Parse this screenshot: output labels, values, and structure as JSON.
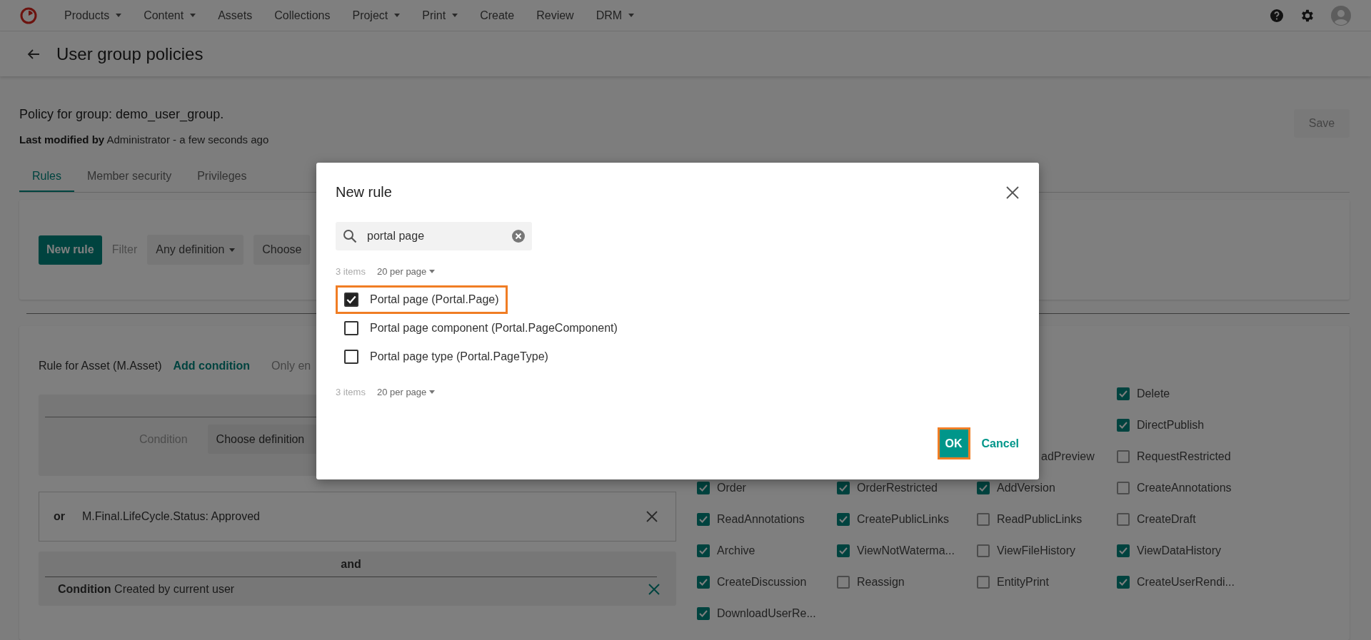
{
  "nav": {
    "items": [
      {
        "label": "Products",
        "dropdown": true
      },
      {
        "label": "Content",
        "dropdown": true
      },
      {
        "label": "Assets",
        "dropdown": false
      },
      {
        "label": "Collections",
        "dropdown": false
      },
      {
        "label": "Project",
        "dropdown": true
      },
      {
        "label": "Print",
        "dropdown": true
      },
      {
        "label": "Create",
        "dropdown": false
      },
      {
        "label": "Review",
        "dropdown": false
      },
      {
        "label": "DRM",
        "dropdown": true
      }
    ]
  },
  "page_header": {
    "title": "User group policies"
  },
  "policy": {
    "heading": "Policy for group: demo_user_group.",
    "modified": "**Last modified by** Administrator - a few seconds ago",
    "save_button": {
      "label": "Save",
      "disabled": true
    }
  },
  "tabs": [
    {
      "label": "Rules",
      "selected": true
    },
    {
      "label": "Member security",
      "selected": false
    },
    {
      "label": "Privileges",
      "selected": false
    }
  ],
  "filter_bar": {
    "new_rule_button": "New rule",
    "filter_label": "Filter",
    "definition_select": "Any definition",
    "choose_select": "Choose"
  },
  "rule": {
    "title": "Rule for Asset (M.Asset)",
    "add_condition": "Add condition",
    "hint": "Only en",
    "condition_label": "Condition",
    "definition_select": "Choose definition",
    "or_row": {
      "operator": "or",
      "text": "M.Final.LifeCycle.Status: Approved"
    },
    "and_group": {
      "operator": "and",
      "condition": "**Condition** Created by current user"
    }
  },
  "permission_rows": [
    [
      null,
      null,
      null,
      {
        "kind": "checkbox",
        "label": "Delete",
        "checked": true
      }
    ],
    [
      null,
      null,
      null,
      {
        "kind": "checkbox",
        "label": "DirectPublish",
        "checked": true
      }
    ],
    [
      null,
      null,
      {
        "kind": "partial",
        "label": "adPreview"
      },
      {
        "kind": "checkbox",
        "label": "RequestRestricted",
        "checked": false
      }
    ],
    [
      {
        "kind": "checkbox",
        "label": "Order",
        "checked": true
      },
      {
        "kind": "checkbox",
        "label": "OrderRestricted",
        "checked": true
      },
      {
        "kind": "checkbox",
        "label": "AddVersion",
        "checked": true
      },
      {
        "kind": "checkbox",
        "label": "CreateAnnotations",
        "checked": false
      }
    ],
    [
      {
        "kind": "checkbox",
        "label": "ReadAnnotations",
        "checked": true
      },
      {
        "kind": "checkbox",
        "label": "CreatePublicLinks",
        "checked": true
      },
      {
        "kind": "checkbox",
        "label": "ReadPublicLinks",
        "checked": false
      },
      {
        "kind": "checkbox",
        "label": "CreateDraft",
        "checked": false
      }
    ],
    [
      {
        "kind": "checkbox",
        "label": "Archive",
        "checked": true
      },
      {
        "kind": "checkbox",
        "label": "ViewNotWaterma...",
        "checked": true
      },
      {
        "kind": "checkbox",
        "label": "ViewFileHistory",
        "checked": false
      },
      {
        "kind": "checkbox",
        "label": "ViewDataHistory",
        "checked": true
      }
    ],
    [
      {
        "kind": "checkbox",
        "label": "CreateDiscussion",
        "checked": true
      },
      {
        "kind": "checkbox",
        "label": "Reassign",
        "checked": false
      },
      {
        "kind": "checkbox",
        "label": "EntityPrint",
        "checked": false
      },
      {
        "kind": "checkbox",
        "label": "CreateUserRendi...",
        "checked": true
      }
    ],
    [
      {
        "kind": "checkbox",
        "label": "DownloadUserRe...",
        "checked": true
      },
      null,
      null,
      null
    ]
  ],
  "modal": {
    "title": "New rule",
    "search": {
      "value": "portal page"
    },
    "count": "3 items",
    "per_page": "20 per page",
    "options": [
      {
        "label": "Portal page (Portal.Page)",
        "checked": true,
        "highlighted": true
      },
      {
        "label": "Portal page component (Portal.PageComponent)",
        "checked": false,
        "highlighted": false
      },
      {
        "label": "Portal page type (Portal.PageType)",
        "checked": false,
        "highlighted": false
      }
    ],
    "footer_count": "3 items",
    "footer_per_page": "20 per page",
    "ok_button": {
      "label": "OK",
      "highlighted": true
    },
    "cancel": "Cancel"
  }
}
